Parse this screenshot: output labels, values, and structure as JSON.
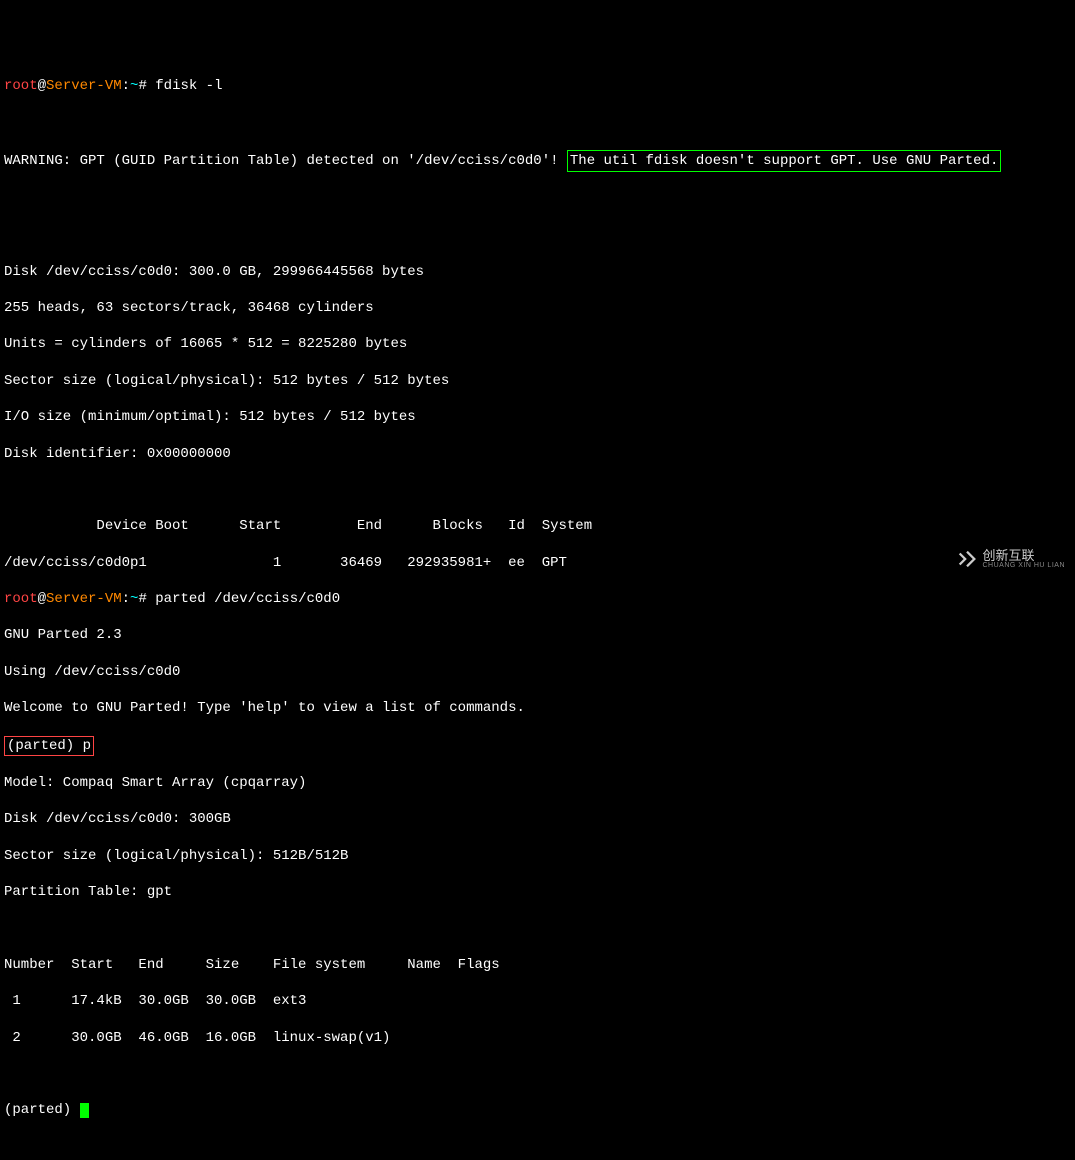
{
  "prompt": {
    "user": "root",
    "host": "Server-VM",
    "path": "~",
    "sep1": "@",
    "sep2": ":",
    "hash": "#"
  },
  "cmd1": "fdisk -l",
  "cmd2": "parted /dev/cciss/c0d0",
  "warning_prefix": "WARNING: GPT (GUID Partition Table) detected on '/dev/cciss/c0d0'!",
  "warning_box": "The util fdisk doesn't support GPT. Use GNU Parted.",
  "disk_info": [
    "Disk /dev/cciss/c0d0: 300.0 GB, 299966445568 bytes",
    "255 heads, 63 sectors/track, 36468 cylinders",
    "Units = cylinders of 16065 * 512 = 8225280 bytes",
    "Sector size (logical/physical): 512 bytes / 512 bytes",
    "I/O size (minimum/optimal): 512 bytes / 512 bytes",
    "Disk identifier: 0x00000000"
  ],
  "fdisk_header": "           Device Boot      Start         End      Blocks   Id  System",
  "fdisk_row": "/dev/cciss/c0d0p1               1       36469   292935981+  ee  GPT",
  "parted_intro": [
    "GNU Parted 2.3",
    "Using /dev/cciss/c0d0",
    "Welcome to GNU Parted! Type 'help' to view a list of commands."
  ],
  "parted_prompt": "(parted)",
  "parted_cmd": "p",
  "parted_model": [
    "Model: Compaq Smart Array (cpqarray)",
    "Disk /dev/cciss/c0d0: 300GB",
    "Sector size (logical/physical): 512B/512B",
    "Partition Table: gpt"
  ],
  "parted_header": "Number  Start   End     Size    File system     Name  Flags",
  "parted_rows": [
    " 1      17.4kB  30.0GB  30.0GB  ext3",
    " 2      30.0GB  46.0GB  16.0GB  linux-swap(v1)"
  ],
  "watermark": {
    "cn": "创新互联",
    "en": "CHUANG XIN HU LIAN"
  },
  "chart_data": {
    "type": "table",
    "fdisk": {
      "columns": [
        "Device",
        "Boot",
        "Start",
        "End",
        "Blocks",
        "Id",
        "System"
      ],
      "rows": [
        {
          "Device": "/dev/cciss/c0d0p1",
          "Boot": "",
          "Start": 1,
          "End": 36469,
          "Blocks": "292935981+",
          "Id": "ee",
          "System": "GPT"
        }
      ]
    },
    "parted": {
      "columns": [
        "Number",
        "Start",
        "End",
        "Size",
        "File system",
        "Name",
        "Flags"
      ],
      "rows": [
        {
          "Number": 1,
          "Start": "17.4kB",
          "End": "30.0GB",
          "Size": "30.0GB",
          "File system": "ext3",
          "Name": "",
          "Flags": ""
        },
        {
          "Number": 2,
          "Start": "30.0GB",
          "End": "46.0GB",
          "Size": "16.0GB",
          "File system": "linux-swap(v1)",
          "Name": "",
          "Flags": ""
        }
      ]
    }
  }
}
